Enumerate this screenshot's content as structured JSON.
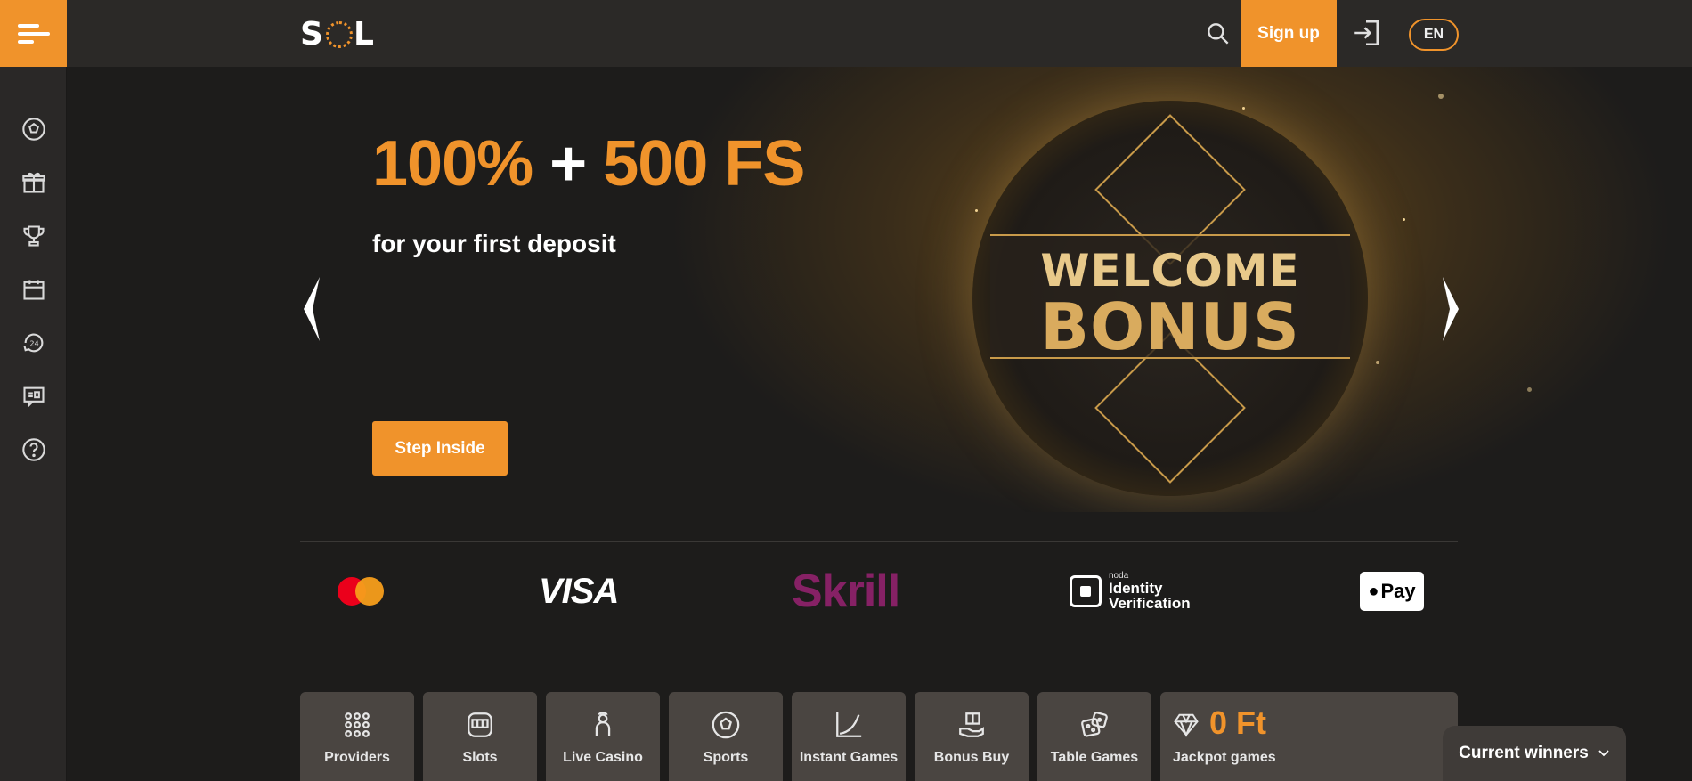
{
  "header": {
    "logo_text_left": "S",
    "logo_text_right": "L",
    "signup_label": "Sign up",
    "lang_label": "EN"
  },
  "sidebar": {
    "items": [
      {
        "icon": "soccer-ball-icon"
      },
      {
        "icon": "gift-icon"
      },
      {
        "icon": "trophy-icon"
      },
      {
        "icon": "calendar-icon"
      },
      {
        "icon": "support-24-icon"
      },
      {
        "icon": "chat-icon"
      },
      {
        "icon": "help-icon"
      }
    ]
  },
  "hero": {
    "title_part1": "100%",
    "title_plus": " + ",
    "title_part2": "500 FS",
    "subtitle": "for your first deposit",
    "cta_label": "Step Inside",
    "coin_line1": "WELCOME",
    "coin_line2": "BONUS"
  },
  "payments": {
    "visa": "VISA",
    "skrill": "Skrill",
    "noda_small": "noda",
    "noda_line1": "Identity",
    "noda_line2": "Verification",
    "applepay": "Pay"
  },
  "categories": [
    {
      "label": "Providers",
      "icon": "grid-dots-icon"
    },
    {
      "label": "Slots",
      "icon": "slot-machine-icon"
    },
    {
      "label": "Live Casino",
      "icon": "dealer-icon"
    },
    {
      "label": "Sports",
      "icon": "soccer-ball-icon"
    },
    {
      "label": "Instant Games",
      "icon": "graph-icon"
    },
    {
      "label": "Bonus Buy",
      "icon": "bonus-hand-icon"
    },
    {
      "label": "Table Games",
      "icon": "dice-icon"
    }
  ],
  "jackpot": {
    "amount": "0 Ft",
    "label": "Jackpot games"
  },
  "winners": {
    "label": "Current winners"
  },
  "colors": {
    "accent": "#f0932b",
    "sidebar_bg": "#2a2827",
    "category_bg": "#4a4541"
  }
}
